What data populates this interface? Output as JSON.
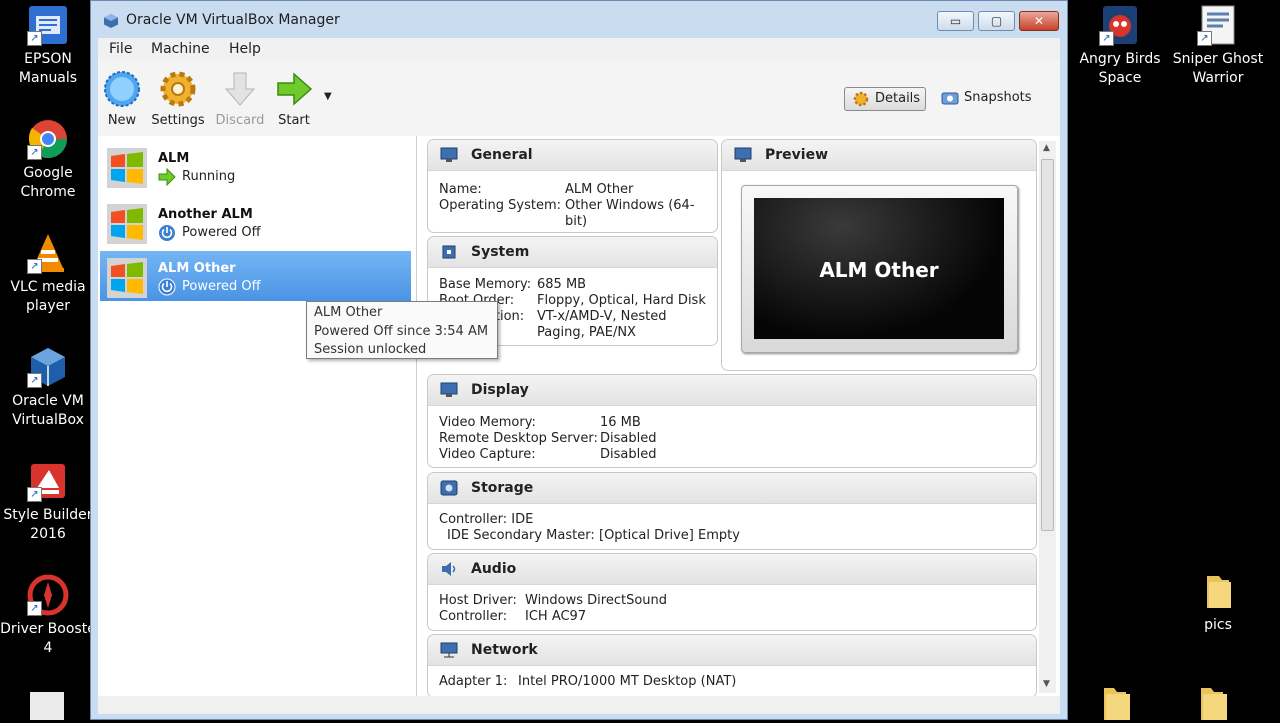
{
  "desktop_left": [
    {
      "label_1": "EPSON",
      "label_2": "Manuals",
      "icon": "epson-manuals-icon"
    },
    {
      "label_1": "Google",
      "label_2": "Chrome",
      "icon": "chrome-icon"
    },
    {
      "label_1": "VLC media",
      "label_2": "player",
      "icon": "vlc-icon"
    },
    {
      "label_1": "Oracle VM",
      "label_2": "VirtualBox",
      "icon": "virtualbox-icon"
    },
    {
      "label_1": "Style Builder",
      "label_2": "2016",
      "icon": "style-builder-icon"
    },
    {
      "label_1": "Driver Booste",
      "label_2": "4",
      "icon": "driver-booster-icon"
    }
  ],
  "desktop_right": [
    {
      "label_1": "Angry Birds",
      "label_2": "Space",
      "icon": "angry-birds-icon"
    },
    {
      "label_1": "Sniper Ghost",
      "label_2": "Warrior",
      "icon": "sniper-ghost-icon"
    },
    {
      "label_1": "pics",
      "label_2": "",
      "icon": "folder-icon"
    }
  ],
  "window": {
    "title": "Oracle VM VirtualBox Manager",
    "min": "▭",
    "max": "▢",
    "close": "✕"
  },
  "menu": [
    "File",
    "Machine",
    "Help"
  ],
  "toolbar": {
    "new": "New",
    "settings": "Settings",
    "discard": "Discard",
    "start": "Start",
    "details": "Details",
    "snapshots": "Snapshots"
  },
  "vms": [
    {
      "name": "ALM",
      "state": "Running"
    },
    {
      "name": "Another ALM",
      "state": "Powered Off"
    },
    {
      "name": "ALM Other",
      "state": "Powered Off"
    }
  ],
  "tooltip": {
    "line1": "ALM Other",
    "line2": "Powered Off since 3:54 AM",
    "line3": "Session unlocked"
  },
  "general": {
    "title": "General",
    "name_label": "Name:",
    "name_value": "ALM Other",
    "os_label": "Operating System:",
    "os_value_1": "Other Windows (64-",
    "os_value_2": "bit)"
  },
  "preview": {
    "title": "Preview",
    "screen_text": "ALM Other"
  },
  "system": {
    "title": "System",
    "mem_label": "Base Memory:",
    "mem_value": "685 MB",
    "boot_label": "Boot Order:",
    "boot_value": "Floppy, Optical, Hard Disk",
    "accel_label": "Acceleration:",
    "accel_value_1": "VT-x/AMD-V, Nested",
    "accel_value_2": "Paging, PAE/NX"
  },
  "display": {
    "title": "Display",
    "vmem_label": "Video Memory:",
    "vmem_value": "16 MB",
    "rds_label": "Remote Desktop Server:",
    "rds_value": "Disabled",
    "cap_label": "Video Capture:",
    "cap_value": "Disabled"
  },
  "storage": {
    "title": "Storage",
    "ctrl_label": "Controller: IDE",
    "ide_label": "IDE Secondary Master:",
    "ide_value": "[Optical Drive] Empty"
  },
  "audio": {
    "title": "Audio",
    "host_label": "Host Driver:",
    "host_value": "Windows DirectSound",
    "ctrl_label": "Controller:",
    "ctrl_value": "ICH AC97"
  },
  "network": {
    "title": "Network",
    "adapter_label": "Adapter 1:",
    "adapter_value": "Intel PRO/1000 MT Desktop (NAT)"
  }
}
